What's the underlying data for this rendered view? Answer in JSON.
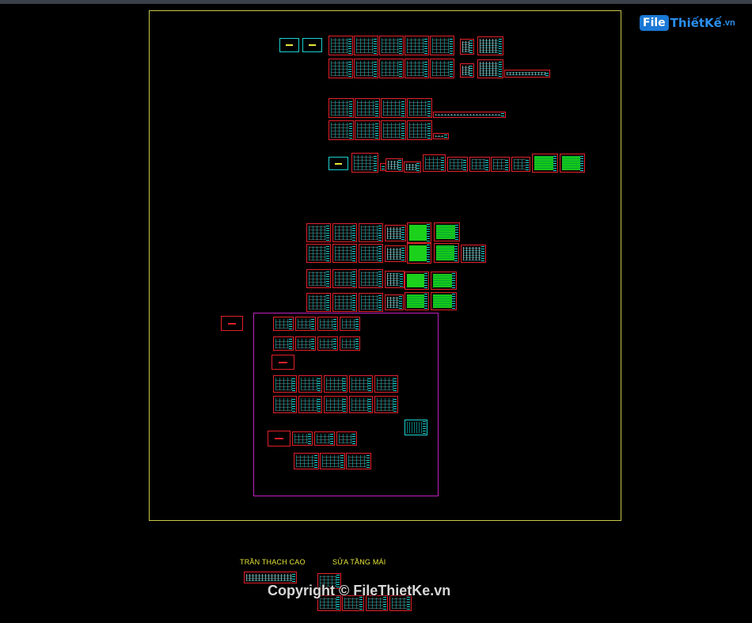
{
  "viewport": {
    "background": "#000000",
    "frame_color": "#c8c84a",
    "group_frame_color": "#c020c0",
    "sheet_border_color": "#e0202a"
  },
  "labels": {
    "ceiling": "TRẦN THẠCH CAO",
    "roof_repair": "SỬA TẦNG MÁI"
  },
  "watermark": {
    "logo_box": "File",
    "logo_rest": "ThiếtKế",
    "logo_domain": ".vn",
    "copyright": "Copyright © FileThietKe.vn"
  }
}
